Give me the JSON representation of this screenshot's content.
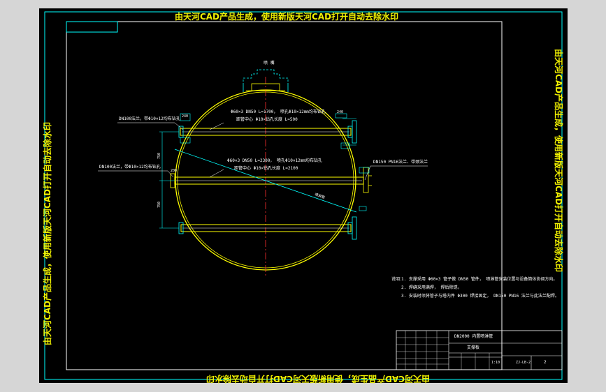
{
  "watermark": {
    "top": "由天河CAD产品生成，使用新版天河CAD打开自动去除水印",
    "bottom": "由天河CAD产品生成，使用新版天河CAD打开自动去除水印",
    "left": "由天河CAD产品生成，使用新版天河CAD打开自动去除水印",
    "right": "由天河CAD产品生成，使用新版天河CAD打开自动去除水印"
  },
  "labels": {
    "top_nozzle": "喷 嘴",
    "pipe1_spec": "Φ60×3  DN50  L=1700， 喷孔Φ10×12mm均布钻孔",
    "pipe1_sub": "距管中心 Φ10×钻孔长度 L=500",
    "pipe1_callout": "DN100法兰，带Φ10×12均布钻孔",
    "pipe2_spec": "Φ60×3  DN50  L=2300， 喷孔Φ10×12mm均布钻孔",
    "pipe2_sub": "距管中心 Φ10×钻孔长度 L=2100",
    "pipe2_callout": "DN100法兰，带Φ10×12均布钻孔",
    "right_callout": "DN150 PN16法兰、带颈法兰",
    "diag_label": "喷淋管",
    "dim_left_top": "750",
    "dim_left_bottom": "750",
    "dim_top_right": "240",
    "dim_top_left": "240",
    "dim_flange": "200"
  },
  "notes": {
    "title": "说明：",
    "lines": [
      "1. 支撑采用 Φ60×3 管子做 DN50 管件， 喷淋管安装位置与设备筒体协调方向。",
      "2. 焊缝采用满焊， 焊后除锈。",
      "3. 安装时须将管子与塔内件 Φ300 焊接固定， DN150 PN16 法兰与此法兰配焊。"
    ]
  },
  "title_block": {
    "drawing_name": "DN2000 内置喷淋管",
    "sub_name": "支撑板",
    "scale": "1:10",
    "sheet": "2",
    "code": "ZJ-LB-2"
  },
  "colors": {
    "canvas": "#000000",
    "frame": "#00ffff",
    "vessel": "#ffff00",
    "line": "#ffffff",
    "dim": "#00ffff",
    "watermark": "#f0f000",
    "centerline": "#ff3030"
  }
}
